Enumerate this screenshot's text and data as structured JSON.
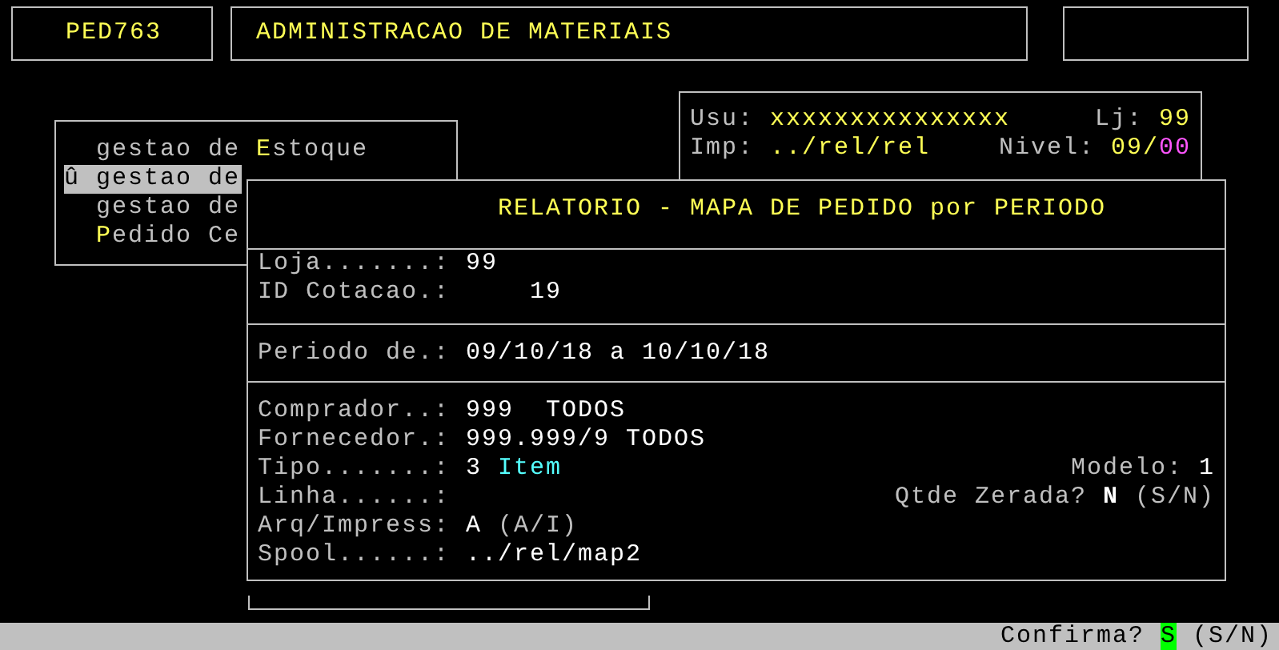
{
  "header": {
    "program_code": "PED763",
    "system_title": "ADMINISTRACAO DE MATERIAIS"
  },
  "user_info": {
    "rows": [
      {
        "label": "Usu:",
        "value": "xxxxxxxxxxxxxxx",
        "right_label": "Lj:",
        "right_value": "99"
      },
      {
        "label": "Imp:",
        "value": "../rel/rel",
        "right_label": "Nivel:",
        "right_value": "09/",
        "right_extra": "00"
      }
    ]
  },
  "menu": {
    "items": [
      {
        "selected": false,
        "parts": [
          {
            "text": "gestao de ",
            "hotkey": false
          },
          {
            "text": "E",
            "hotkey": true
          },
          {
            "text": "stoque",
            "hotkey": false
          }
        ]
      },
      {
        "selected": true,
        "marker": "û",
        "parts": [
          {
            "text": "gestao de",
            "hotkey": false
          }
        ]
      },
      {
        "selected": false,
        "parts": [
          {
            "text": "gestao de",
            "hotkey": false
          }
        ]
      },
      {
        "selected": false,
        "parts": [
          {
            "text": "P",
            "hotkey": true
          },
          {
            "text": "edido Ce",
            "hotkey": false
          }
        ]
      }
    ]
  },
  "report_dialog": {
    "title": "RELATORIO - MAPA DE PEDIDO por PERIODO",
    "sections": [
      {
        "fields": [
          {
            "label": "Loja.......:",
            "value": "99"
          },
          {
            "label": "ID Cotacao.:",
            "value": "    19"
          }
        ]
      },
      {
        "fields": [
          {
            "label": "Periodo de.:",
            "value": "09/10/18 a 10/10/18"
          }
        ]
      },
      {
        "fields": [
          {
            "label": "Comprador..:",
            "value": "999  TODOS"
          },
          {
            "label": "Fornecedor.:",
            "value": "999.999/9 TODOS"
          },
          {
            "label": "Tipo.......:",
            "value": "3",
            "detail": "Item",
            "side": {
              "label": "Modelo:",
              "value": "1"
            }
          },
          {
            "label": "Linha......:",
            "side": {
              "label": "Qtde Zerada?",
              "value": "N",
              "hint": "(S/N)"
            }
          },
          {
            "label": "Arq/Impress:",
            "value": "A",
            "hint": "(A/I)"
          },
          {
            "label": "Spool......:",
            "value": "../rel/map2"
          }
        ]
      }
    ]
  },
  "status_bar": {
    "prompt": "Confirma?",
    "answer": "S",
    "options": "(S/N)"
  }
}
